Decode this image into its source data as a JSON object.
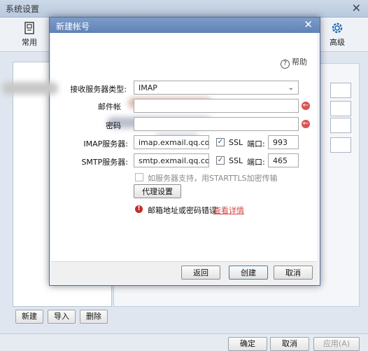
{
  "background": {
    "window_title": "系统设置",
    "toolbar": {
      "general_label": "常用",
      "advanced_label": "高级"
    },
    "buttons": {
      "new": "新建",
      "import": "导入",
      "delete": "删除",
      "ok": "确定",
      "cancel": "取消",
      "apply": "应用(A)"
    }
  },
  "dialog": {
    "title": "新建帐号",
    "help": "帮助",
    "form": {
      "server_type_label": "接收服务器类型:",
      "server_type_value": "IMAP",
      "email_label": "邮件帐",
      "password_label": "密码",
      "imap_label": "IMAP服务器:",
      "imap_value": "imap.exmail.qq.com",
      "imap_ssl_label": "SSL",
      "imap_port_label": "端口:",
      "imap_port_value": "993",
      "smtp_label": "SMTP服务器:",
      "smtp_value": "smtp.exmail.qq.com",
      "smtp_ssl_label": "SSL",
      "smtp_port_label": "端口:",
      "smtp_port_value": "465",
      "starttls_label": "如服务器支持，用STARTTLS加密传输",
      "proxy_button": "代理设置",
      "error_text": "邮箱地址或密码错误",
      "error_link": "查看详情"
    },
    "footer": {
      "back": "返回",
      "create": "创建",
      "cancel": "取消"
    }
  },
  "colors": {
    "dialog_title_bg": "#5f82b8",
    "error_red": "#d64545",
    "ssl_check": "#1b4fa8"
  }
}
